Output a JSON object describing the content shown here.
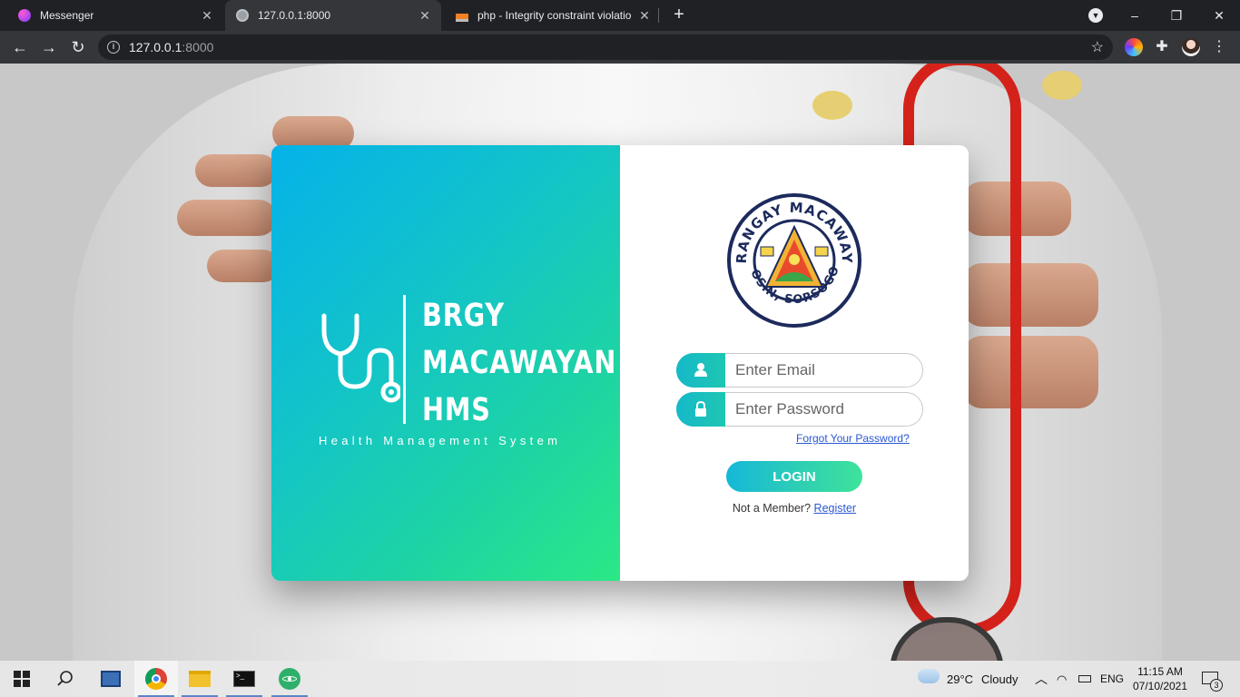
{
  "browser": {
    "tabs": [
      {
        "label": "Messenger",
        "active": false
      },
      {
        "label": "127.0.0.1:8000",
        "active": true
      },
      {
        "label": "php - Integrity constraint violatio",
        "active": false
      }
    ],
    "address": {
      "host": "127.0.0.1",
      "port": ":8000"
    },
    "window_controls": {
      "minimize": "–",
      "restore": "❐",
      "close": "✕"
    }
  },
  "brand": {
    "title_line1": "BRGY",
    "title_line2": "MACAWAYAN",
    "title_line3": "HMS",
    "subtitle": "Health Management System"
  },
  "seal": {
    "top_text": "BARANGAY MACAWAYAN",
    "bottom_text": "IROSIN, SORSOGON"
  },
  "login_form": {
    "email_placeholder": "Enter Email",
    "password_placeholder": "Enter Password",
    "forgot_label": "Forgot Your Password?",
    "login_label": "LOGIN",
    "not_member_text": "Not a Member?",
    "register_label": "Register"
  },
  "taskbar": {
    "weather_temp": "29°C",
    "weather_desc": "Cloudy",
    "language": "ENG",
    "time": "11:15 AM",
    "date": "07/10/2021",
    "notification_count": "3"
  },
  "colors": {
    "gradient_start": "#05b2e9",
    "gradient_end": "#2be886",
    "link": "#2a58d2"
  }
}
